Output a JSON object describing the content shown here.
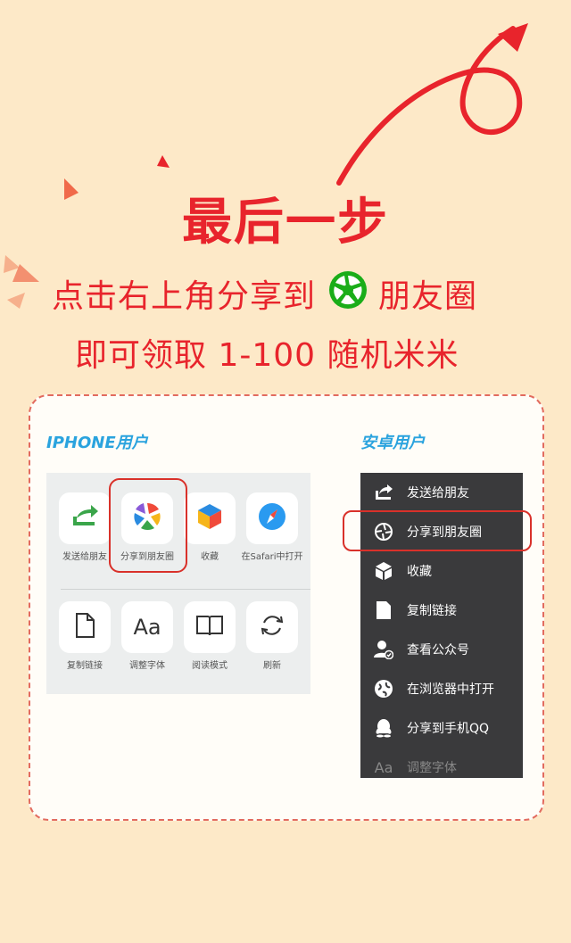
{
  "headline": "最后一步",
  "instruction": {
    "part1": "点击右上角分享到",
    "part2": "朋友圈"
  },
  "reward": "即可领取 1-100 随机米米",
  "colors": {
    "accent_red": "#e8242c",
    "label_blue": "#2aa3de",
    "background": "#fde9c8",
    "moments_green": "#1aad19"
  },
  "iphone": {
    "label": "IPHONE用户",
    "row1": [
      {
        "icon": "share-forward-icon",
        "label": "发送给朋友"
      },
      {
        "icon": "moments-icon",
        "label": "分享到朋友圈"
      },
      {
        "icon": "cube-icon",
        "label": "收藏"
      },
      {
        "icon": "safari-icon",
        "label": "在Safari中打开"
      }
    ],
    "row2": [
      {
        "icon": "document-icon",
        "label": "复制链接"
      },
      {
        "icon": "font-icon",
        "label": "调整字体"
      },
      {
        "icon": "book-icon",
        "label": "阅读模式"
      },
      {
        "icon": "refresh-icon",
        "label": "刷新"
      }
    ]
  },
  "android": {
    "label": "安卓用户",
    "items": [
      {
        "icon": "share-forward-icon",
        "label": "发送给朋友"
      },
      {
        "icon": "moments-icon",
        "label": "分享到朋友圈"
      },
      {
        "icon": "cube-icon",
        "label": "收藏"
      },
      {
        "icon": "document-icon",
        "label": "复制链接"
      },
      {
        "icon": "user-check-icon",
        "label": "查看公众号"
      },
      {
        "icon": "globe-icon",
        "label": "在浏览器中打开"
      },
      {
        "icon": "qq-icon",
        "label": "分享到手机QQ"
      },
      {
        "icon": "font-icon",
        "label": "调整字体"
      }
    ]
  }
}
